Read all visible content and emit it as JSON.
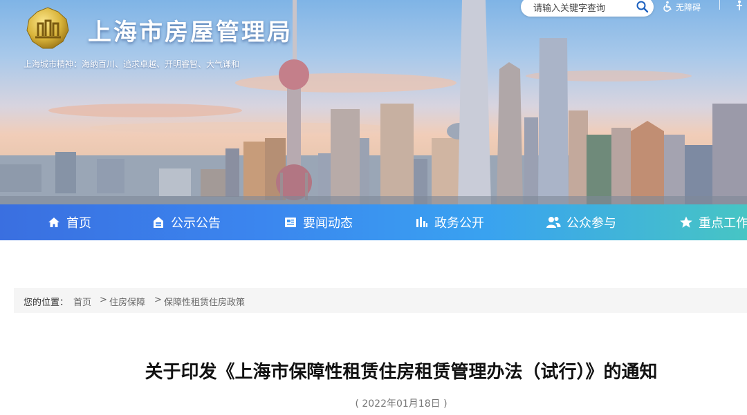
{
  "header": {
    "site_title": "上海市房屋管理局",
    "slogan": "上海城市精神：海纳百川、追求卓越、开明睿智、大气谦和",
    "search_placeholder": "请输入关键字查询",
    "accessibility_label": "无障碍"
  },
  "nav": {
    "items": [
      {
        "label": "首页",
        "icon": "home-icon"
      },
      {
        "label": "公示公告",
        "icon": "notice-icon"
      },
      {
        "label": "要闻动态",
        "icon": "news-icon"
      },
      {
        "label": "政务公开",
        "icon": "chart-bars-icon"
      },
      {
        "label": "公众参与",
        "icon": "people-icon"
      },
      {
        "label": "重点工作",
        "icon": "star-icon"
      }
    ]
  },
  "breadcrumb": {
    "prefix": "您的位置：",
    "items": [
      "首页",
      "住房保障",
      "保障性租赁住房政策"
    ],
    "separator": ">"
  },
  "article": {
    "title": "关于印发《上海市保障性租赁住房租赁管理办法（试行）》的通知",
    "date": "( 2022年01月18日 )"
  },
  "colors": {
    "nav_gradient_start": "#3a6fe0",
    "nav_gradient_end": "#47c5c4",
    "logo_gold": "#d9b43a",
    "title_text": "#111111"
  }
}
